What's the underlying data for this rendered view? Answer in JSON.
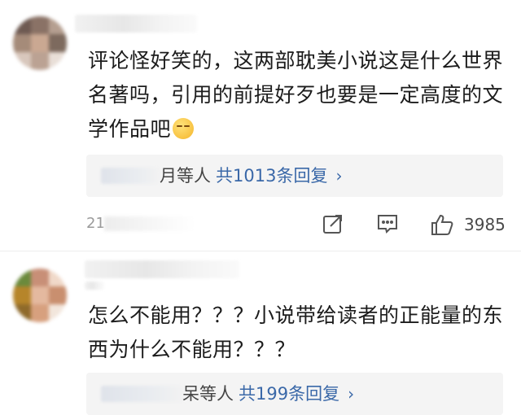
{
  "comments": [
    {
      "text": "评论怪好笑的，这两部耽美小说这是什么世界名著吗，引用的前提好歹也要是一定高度的文学作品吧",
      "emoji": "sleepy-face-emoji",
      "replies": {
        "users_suffix": "月等人",
        "count_label": "共1013条回复",
        "chevron": "›"
      },
      "timestamp": "21",
      "likes": "3985"
    },
    {
      "text": "怎么不能用？？？小说带给读者的正能量的东西为什么不能用？？？",
      "replies": {
        "users_suffix": "呆等人",
        "count_label": "共199条回复",
        "chevron": "›"
      }
    }
  ],
  "icons": {
    "share": "share-icon",
    "comment": "comment-icon",
    "like": "thumbs-up-icon"
  },
  "colors": {
    "link_blue": "#3a68a8",
    "reply_bg": "#f4f4f4",
    "meta_gray": "#9a9a9a"
  }
}
